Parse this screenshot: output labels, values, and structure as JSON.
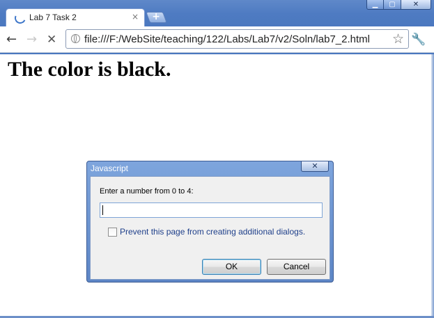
{
  "browser": {
    "tab_title": "Lab 7 Task 2",
    "tab_close_glyph": "×",
    "new_tab_glyph": "+",
    "url": "file:///F:/WebSite/teaching/122/Labs/Lab7/v2/Soln/lab7_2.html",
    "back_icon": "←",
    "forward_icon": "→",
    "stop_icon": "✕",
    "star_icon": "☆",
    "wrench_icon": "🔧",
    "window_controls": {
      "minimize": "▁",
      "maximize": "▢",
      "close": "✕"
    },
    "accent_color": "#4e7bc2"
  },
  "page": {
    "heading": "The color is black."
  },
  "dialog": {
    "title": "Javascript",
    "close_glyph": "✕",
    "prompt": "Enter a number from 0 to 4:",
    "input_value": "",
    "checkbox_label": "Prevent this page from creating additional dialogs.",
    "checkbox_checked": false,
    "ok_label": "OK",
    "cancel_label": "Cancel"
  }
}
